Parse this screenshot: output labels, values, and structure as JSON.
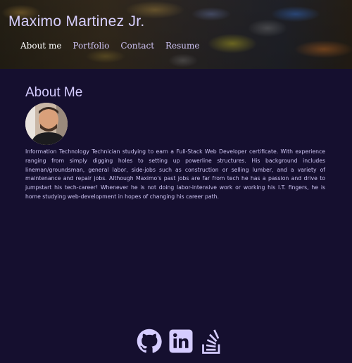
{
  "header": {
    "title": "Maximo Martinez Jr.",
    "nav": [
      {
        "label": "About me"
      },
      {
        "label": "Portfolio"
      },
      {
        "label": "Contact"
      },
      {
        "label": "Resume"
      }
    ]
  },
  "about": {
    "heading": "About Me",
    "bio": "Information Technology Technician studying to earn a Full-Stack Web Developer certificate. With experience ranging from simply digging holes to setting up powerline structures. His background includes lineman/groundsman, general labor, side-jobs such as construction or selling lumber, and a variety of maintenance and repair jobs. Although Maximo's past jobs are far from tech he has a passion and drive to jumpstart his tech-career! Whenever he is not doing labor-intensive work or working his I.T. fingers, he is home studying web-development in hopes of changing his career path."
  },
  "socials": [
    {
      "icon": "github-icon"
    },
    {
      "icon": "linkedin-icon"
    },
    {
      "icon": "stackoverflow-icon"
    }
  ],
  "colors": {
    "background": "#150f2f",
    "accent": "#d5ccff"
  }
}
